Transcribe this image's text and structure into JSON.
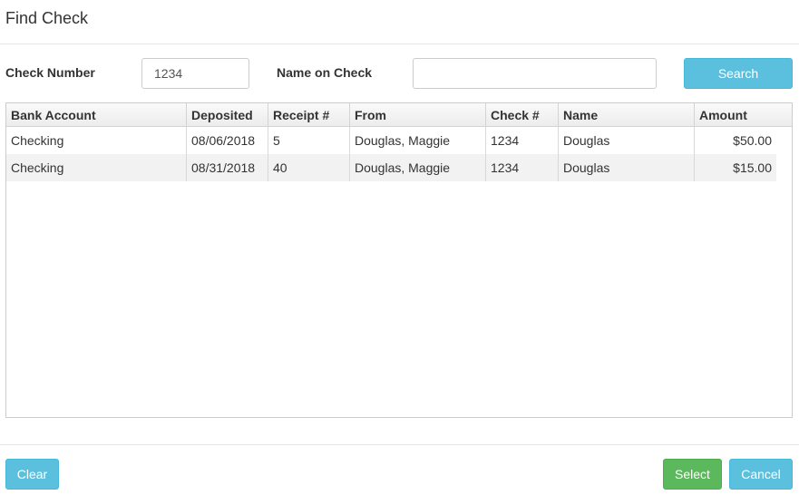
{
  "dialog": {
    "title": "Find Check"
  },
  "search": {
    "check_number_label": "Check Number",
    "check_number_value": "1234",
    "name_on_check_label": "Name on Check",
    "name_on_check_value": "",
    "search_label": "Search"
  },
  "table": {
    "columns": [
      "Bank Account",
      "Deposited",
      "Receipt #",
      "From",
      "Check #",
      "Name",
      "Amount"
    ],
    "rows": [
      [
        "Checking",
        "08/06/2018",
        "5",
        "Douglas, Maggie",
        "1234",
        "Douglas",
        "$50.00"
      ],
      [
        "Checking",
        "08/31/2018",
        "40",
        "Douglas, Maggie",
        "1234",
        "Douglas",
        "$15.00"
      ]
    ]
  },
  "footer": {
    "clear_label": "Clear",
    "select_label": "Select",
    "cancel_label": "Cancel"
  },
  "colors": {
    "info_button": "#5bc0de",
    "success_button": "#5cb85c"
  }
}
